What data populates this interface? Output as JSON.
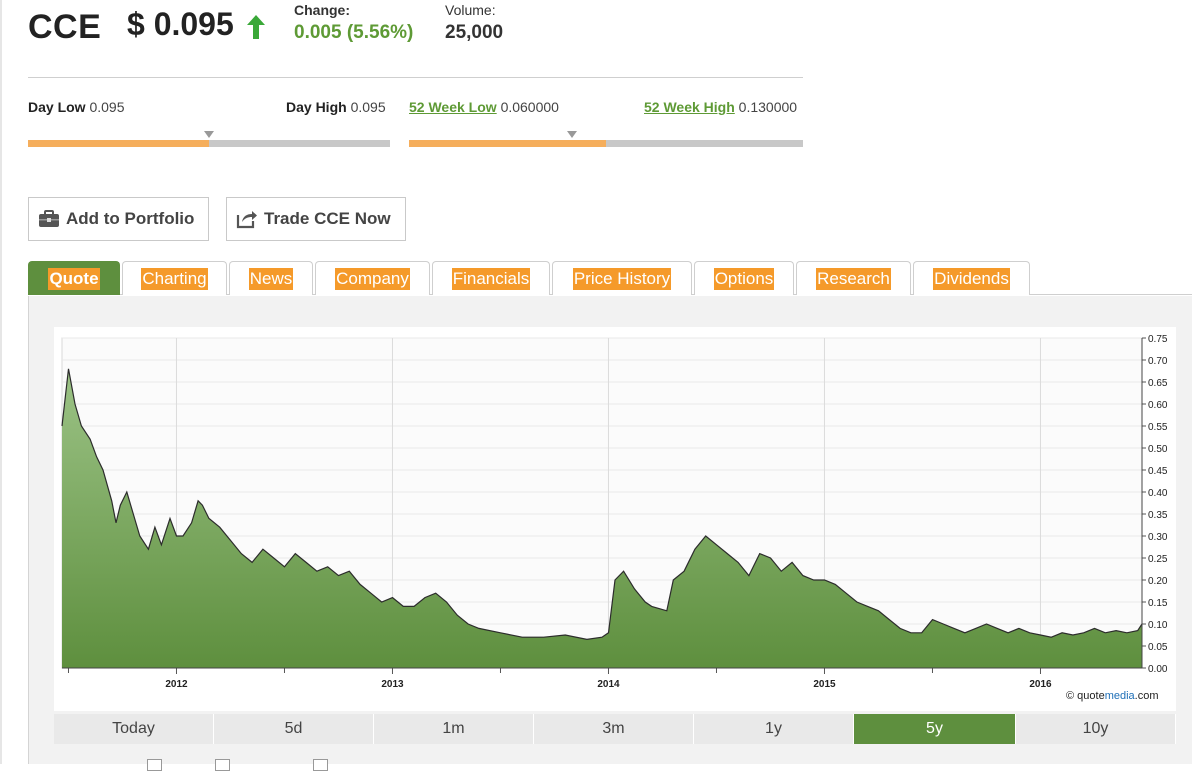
{
  "quote": {
    "ticker": "CCE",
    "price": "$ 0.095",
    "change_label": "Change:",
    "change_value": "0.005 (5.56%)",
    "volume_label": "Volume:",
    "volume_value": "25,000",
    "direction": "up"
  },
  "ranges": {
    "day_low_label": "Day Low",
    "day_low_value": "0.095",
    "day_high_label": "Day High",
    "day_high_value": "0.095",
    "day_range_fill_fraction": 0.5,
    "week52_low_label": "52 Week Low",
    "week52_low_value": "0.060000",
    "week52_high_label": "52 Week High",
    "week52_high_value": "0.130000",
    "week52_range_fill_fraction": 0.5
  },
  "actions": {
    "add_portfolio": "Add to Portfolio",
    "trade_now": "Trade CCE Now"
  },
  "tabs": [
    {
      "label": "Quote",
      "active": true
    },
    {
      "label": "Charting"
    },
    {
      "label": "News"
    },
    {
      "label": "Company"
    },
    {
      "label": "Financials"
    },
    {
      "label": "Price History"
    },
    {
      "label": "Options"
    },
    {
      "label": "Research"
    },
    {
      "label": "Dividends"
    }
  ],
  "range_buttons": [
    {
      "label": "Today"
    },
    {
      "label": "5d"
    },
    {
      "label": "1m"
    },
    {
      "label": "3m"
    },
    {
      "label": "1y"
    },
    {
      "label": "5y",
      "active": true
    },
    {
      "label": "10y"
    }
  ],
  "credit": {
    "pre": "© quote",
    "brand": "media",
    "post": ".com"
  },
  "colors": {
    "accent_green": "#5e8f3e",
    "tab_orange": "#f59a2a",
    "area_top": "#9cc386",
    "area_bottom": "#5e8f3e",
    "range_fill": "#f5ae5c"
  },
  "chart_data": {
    "type": "area",
    "x_ticks": [
      "2012",
      "2013",
      "2014",
      "2015",
      "2016"
    ],
    "y_ticks": [
      "0.00",
      "0.05",
      "0.10",
      "0.15",
      "0.20",
      "0.25",
      "0.30",
      "0.35",
      "0.40",
      "0.45",
      "0.50",
      "0.55",
      "0.60",
      "0.65",
      "0.70",
      "0.75"
    ],
    "ylim": [
      0,
      0.75
    ],
    "xlim": [
      2011.47,
      2016.47
    ],
    "grid": true,
    "series": [
      {
        "x": [
          2011.47,
          2011.5,
          2011.53,
          2011.56,
          2011.6,
          2011.63,
          2011.66,
          2011.7,
          2011.72,
          2011.74,
          2011.77,
          2011.8,
          2011.83,
          2011.87,
          2011.9,
          2011.93,
          2011.97,
          2012.0,
          2012.03,
          2012.07,
          2012.1,
          2012.12,
          2012.15,
          2012.2,
          2012.25,
          2012.3,
          2012.35,
          2012.4,
          2012.45,
          2012.5,
          2012.55,
          2012.6,
          2012.65,
          2012.7,
          2012.75,
          2012.8,
          2012.85,
          2012.9,
          2012.95,
          2013.0,
          2013.05,
          2013.1,
          2013.15,
          2013.2,
          2013.25,
          2013.3,
          2013.35,
          2013.4,
          2013.5,
          2013.6,
          2013.7,
          2013.8,
          2013.9,
          2013.97,
          2014.0,
          2014.03,
          2014.07,
          2014.12,
          2014.17,
          2014.2,
          2014.27,
          2014.3,
          2014.35,
          2014.4,
          2014.45,
          2014.5,
          2014.55,
          2014.6,
          2014.65,
          2014.7,
          2014.75,
          2014.8,
          2014.85,
          2014.9,
          2014.95,
          2015.0,
          2015.05,
          2015.1,
          2015.15,
          2015.2,
          2015.25,
          2015.3,
          2015.35,
          2015.4,
          2015.45,
          2015.5,
          2015.55,
          2015.6,
          2015.65,
          2015.7,
          2015.75,
          2015.8,
          2015.85,
          2015.9,
          2015.95,
          2016.0,
          2016.05,
          2016.1,
          2016.15,
          2016.2,
          2016.25,
          2016.3,
          2016.35,
          2016.4,
          2016.45,
          2016.47
        ],
        "y": [
          0.55,
          0.68,
          0.6,
          0.55,
          0.52,
          0.48,
          0.45,
          0.38,
          0.33,
          0.37,
          0.4,
          0.35,
          0.3,
          0.27,
          0.32,
          0.28,
          0.34,
          0.3,
          0.3,
          0.33,
          0.38,
          0.37,
          0.34,
          0.32,
          0.29,
          0.26,
          0.24,
          0.27,
          0.25,
          0.23,
          0.26,
          0.24,
          0.22,
          0.23,
          0.21,
          0.22,
          0.19,
          0.17,
          0.15,
          0.16,
          0.14,
          0.14,
          0.16,
          0.17,
          0.15,
          0.12,
          0.1,
          0.09,
          0.08,
          0.07,
          0.07,
          0.075,
          0.065,
          0.07,
          0.08,
          0.2,
          0.22,
          0.18,
          0.15,
          0.14,
          0.13,
          0.2,
          0.22,
          0.27,
          0.3,
          0.28,
          0.26,
          0.24,
          0.21,
          0.26,
          0.25,
          0.22,
          0.24,
          0.21,
          0.2,
          0.2,
          0.19,
          0.17,
          0.15,
          0.14,
          0.13,
          0.11,
          0.09,
          0.08,
          0.08,
          0.11,
          0.1,
          0.09,
          0.08,
          0.09,
          0.1,
          0.09,
          0.08,
          0.09,
          0.08,
          0.075,
          0.07,
          0.08,
          0.075,
          0.08,
          0.09,
          0.08,
          0.085,
          0.08,
          0.085,
          0.1
        ]
      }
    ]
  }
}
